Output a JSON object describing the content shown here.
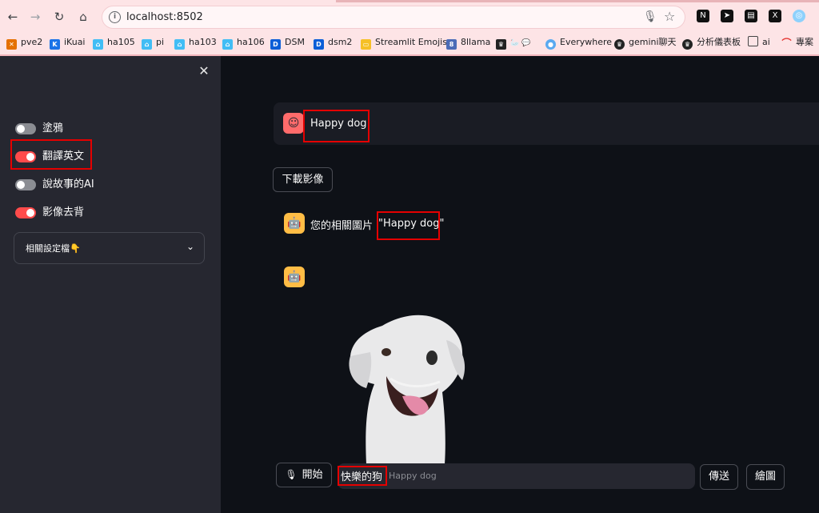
{
  "browser": {
    "url": "localhost:8502",
    "bookmarks": [
      "pve2",
      "iKuai",
      "ha105",
      "pi",
      "ha103",
      "ha106",
      "DSM",
      "dsm2",
      "Streamlit Emojis",
      "8llama",
      "Everywhere",
      "gemini聊天",
      "分析儀表板",
      "ai",
      "專案"
    ],
    "colors": {
      "tab_strip": "#fde4e6",
      "accent_red": "#ff4b4b"
    }
  },
  "sidebar": {
    "close_icon": "close-icon",
    "toggles": [
      {
        "label": "塗鴉",
        "on": false
      },
      {
        "label": "翻譯英文",
        "on": true
      },
      {
        "label": "說故事的AI",
        "on": false
      },
      {
        "label": "影像去背",
        "on": true
      }
    ],
    "expander_label": "相關設定檔👇"
  },
  "main": {
    "user_message": "Happy dog",
    "download_button": "下載影像",
    "bot_message_prefix": "您的相關圖片",
    "bot_message_quote": "\"Happy dog\"",
    "start_button": "開始",
    "chat_typed": "快樂的狗",
    "chat_placeholder": "Happy dog",
    "send_button": "傳送",
    "draw_button": "繪圖"
  },
  "colors": {
    "app_bg": "#0e1117",
    "sidebar_bg": "#262730",
    "user_avatar": "#ff6b6b",
    "bot_avatar": "#ffbd45",
    "highlight_box": "#e50000"
  }
}
